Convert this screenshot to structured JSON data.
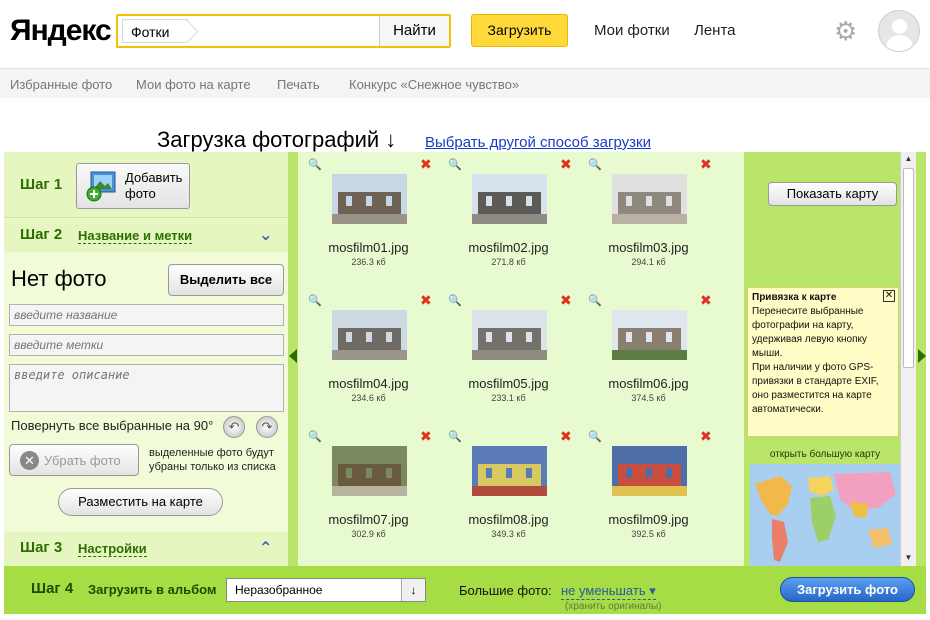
{
  "header": {
    "logo": "Яндекс",
    "search_tag": "Фотки",
    "search_button": "Найти",
    "upload_button": "Загрузить",
    "links": [
      "Мои фотки",
      "Лента"
    ],
    "icons": {
      "settings": "gear-icon",
      "avatar": "user-avatar-icon"
    }
  },
  "subnav": [
    "Избранные фото",
    "Мои фото на карте",
    "Печать",
    "Конкурс «Снежное чувство»"
  ],
  "page": {
    "title": "Загрузка фотографий ↓",
    "alt_link": "Выбрать другой способ загрузки"
  },
  "left": {
    "step1": {
      "title": "Шаг 1",
      "add_button": "Добавить фото"
    },
    "step2": {
      "title": "Шаг 2",
      "link": "Название и метки"
    },
    "no_photo": "Нет фото",
    "select_all": "Выделить все",
    "name_placeholder": "введите название",
    "tags_placeholder": "введите метки",
    "desc_placeholder": "введите описание",
    "rotate_label": "Повернуть все выбранные на 90°",
    "remove_button": "Убрать фото",
    "remove_note": "выделенные фото будут убраны только из списка",
    "place_button": "Разместить на карте",
    "step3": {
      "title": "Шаг 3",
      "link": "Настройки"
    }
  },
  "photos": [
    {
      "name": "mosfilm01.jpg",
      "size": "236.3 кб"
    },
    {
      "name": "mosfilm02.jpg",
      "size": "271.8 кб"
    },
    {
      "name": "mosfilm03.jpg",
      "size": "294.1 кб"
    },
    {
      "name": "mosfilm04.jpg",
      "size": "234.6 кб"
    },
    {
      "name": "mosfilm05.jpg",
      "size": "233.1 кб"
    },
    {
      "name": "mosfilm06.jpg",
      "size": "374.5 кб"
    },
    {
      "name": "mosfilm07.jpg",
      "size": "302.9 кб"
    },
    {
      "name": "mosfilm08.jpg",
      "size": "349.3 кб"
    },
    {
      "name": "mosfilm09.jpg",
      "size": "392.5 кб"
    }
  ],
  "map": {
    "show_map": "Показать карту",
    "tooltip_title": "Привязка к карте",
    "tooltip_text": "Перенесите выбранные фотографии на карту, удерживая левую кнопку мыши.",
    "tooltip_text2": "При наличии у фото GPS-привязки в стандарте EXIF, оно разместится на карте автоматически.",
    "big_map_link": "открыть большую карту"
  },
  "footer": {
    "step4": "Шаг 4",
    "album_label": "Загрузить в альбом",
    "album_value": "Неразобранное",
    "big_photo_label": "Большие фото:",
    "big_photo_value": "не уменьшать ▾",
    "big_photo_note": "(хранить оригиналы)",
    "submit": "Загрузить фото"
  }
}
